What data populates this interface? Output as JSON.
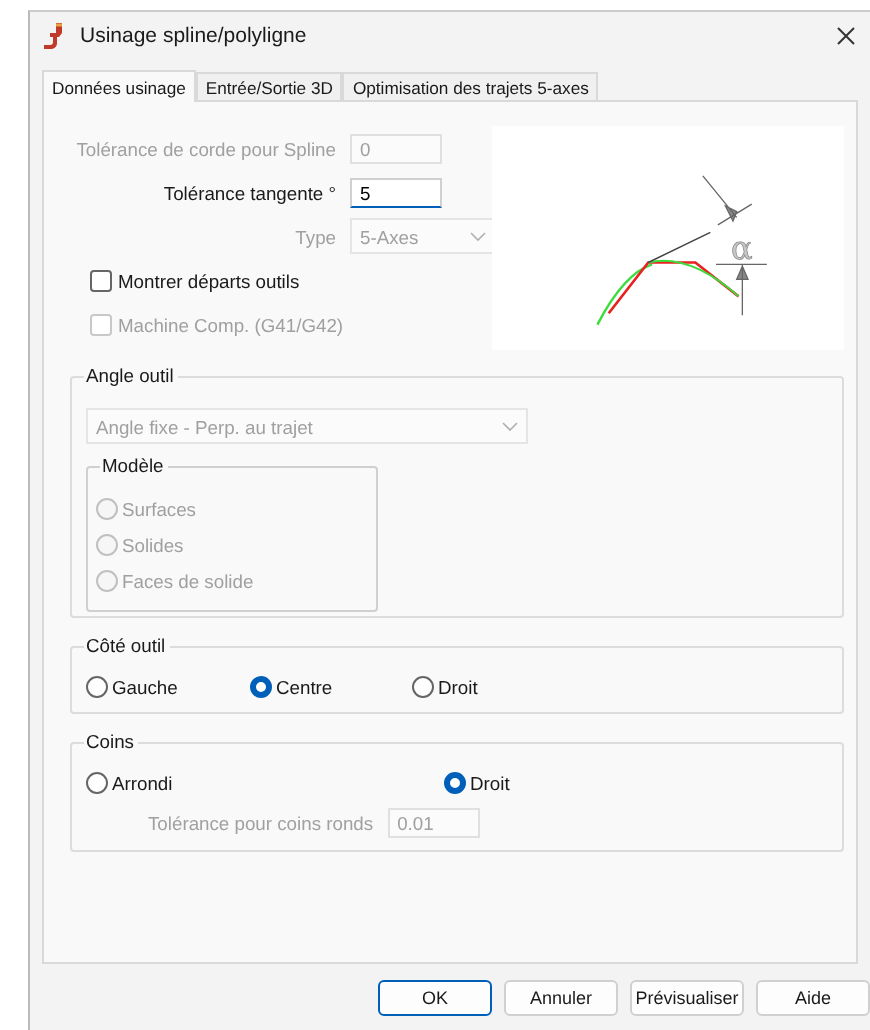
{
  "window": {
    "title": "Usinage spline/polyligne"
  },
  "tabs": [
    {
      "label": "Données usinage",
      "selected": true
    },
    {
      "label": "Entrée/Sortie 3D",
      "selected": false
    },
    {
      "label": "Optimisation des trajets 5-axes",
      "selected": false
    }
  ],
  "fields": [
    {
      "kind": "text",
      "label": "Tolérance de corde pour Spline",
      "value": "0",
      "disabled": true
    },
    {
      "kind": "text",
      "label": "Tolérance tangente °",
      "value": "5",
      "disabled": false
    },
    {
      "kind": "select",
      "label": "Type",
      "value": "5-Axes",
      "disabled": true
    }
  ],
  "checkboxes": [
    {
      "label": "Montrer départs outils",
      "checked": false,
      "disabled": false
    },
    {
      "label": "Machine Comp. (G41/G42)",
      "checked": false,
      "disabled": true
    }
  ],
  "diagram": {
    "symbol": "α"
  },
  "tool_angle": {
    "title": "Angle outil",
    "dropdown": {
      "value": "Angle fixe - Perp. au trajet",
      "disabled": true
    },
    "model": {
      "title": "Modèle",
      "options": [
        {
          "label": "Surfaces",
          "selected": false,
          "disabled": true
        },
        {
          "label": "Solides",
          "selected": false,
          "disabled": true
        },
        {
          "label": "Faces de solide",
          "selected": false,
          "disabled": true
        }
      ]
    }
  },
  "tool_side": {
    "title": "Côté outil",
    "options": [
      {
        "label": "Gauche",
        "selected": false,
        "disabled": false
      },
      {
        "label": "Centre",
        "selected": true,
        "disabled": false
      },
      {
        "label": "Droit",
        "selected": false,
        "disabled": false
      }
    ]
  },
  "corners": {
    "title": "Coins",
    "options": [
      {
        "label": "Arrondi",
        "selected": false,
        "disabled": false
      },
      {
        "label": "Droit",
        "selected": true,
        "disabled": false
      }
    ],
    "field": {
      "label": "Tolérance pour coins ronds",
      "value": "0.01",
      "disabled": true
    }
  },
  "buttons": [
    {
      "label": "OK",
      "default": true
    },
    {
      "label": "Annuler",
      "default": false
    },
    {
      "label": "Prévisualiser",
      "default": false
    },
    {
      "label": "Aide",
      "default": false
    }
  ]
}
